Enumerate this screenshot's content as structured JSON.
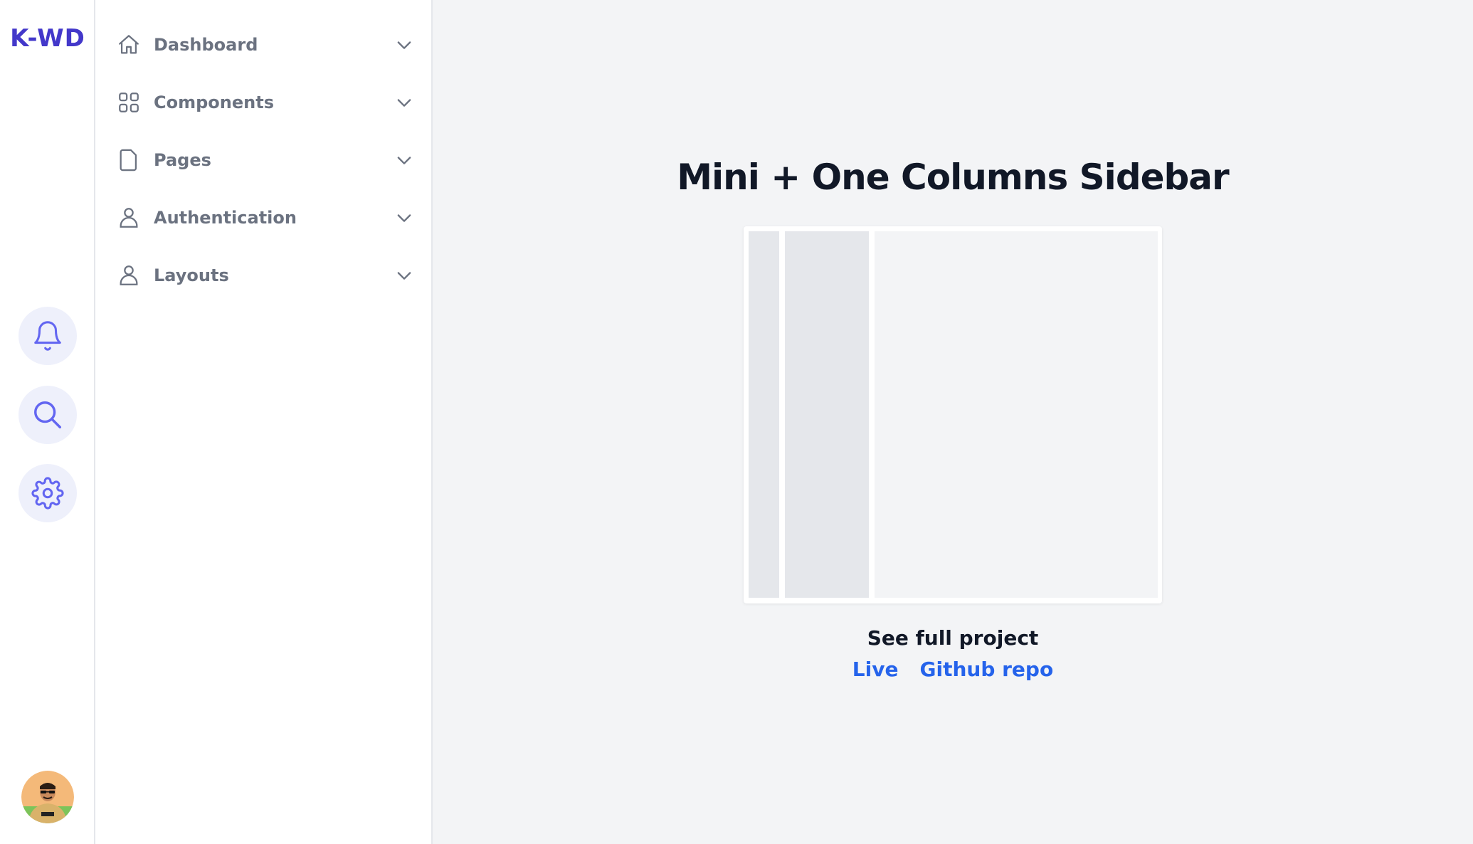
{
  "brand": {
    "logo_text": "K-WD",
    "accent": "#4338ca"
  },
  "mini_sidebar": {
    "buttons": [
      {
        "icon": "bell-icon"
      },
      {
        "icon": "search-icon"
      },
      {
        "icon": "gear-icon"
      }
    ],
    "icon_color": "#6366f1",
    "button_bg": "#eef0fb"
  },
  "sidebar": {
    "items": [
      {
        "label": "Dashboard",
        "icon": "home-icon"
      },
      {
        "label": "Components",
        "icon": "grid-icon"
      },
      {
        "label": "Pages",
        "icon": "document-icon"
      },
      {
        "label": "Authentication",
        "icon": "user-icon"
      },
      {
        "label": "Layouts",
        "icon": "user-icon"
      }
    ]
  },
  "main": {
    "title": "Mini + One Columns Sidebar",
    "see_full_project": "See full project",
    "links": {
      "live": "Live",
      "github": "Github repo"
    },
    "link_color": "#2563eb"
  }
}
